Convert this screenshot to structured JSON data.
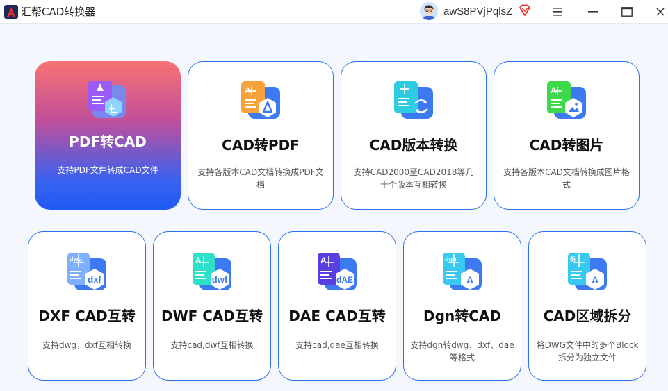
{
  "app": {
    "title": "汇帮CAD转换器",
    "username": "awS8PVjPqlsZ"
  },
  "icons": {
    "logo": "app-logo-icon",
    "avatar": "user-avatar",
    "vip": "vip-diamond-icon",
    "menu": "hamburger-menu-icon",
    "minimize": "minimize-icon",
    "maximize": "maximize-icon",
    "close": "close-icon"
  },
  "colors": {
    "accent": "#2a6ff0",
    "active_gradient_top": "#f87272",
    "active_gradient_bottom": "#1e5af2",
    "background": "#f4f7fd"
  },
  "cards": [
    {
      "title": "PDF转CAD",
      "desc": "支持PDF文件转成CAD文件",
      "active": true,
      "icon": "pdf-to-cad-icon"
    },
    {
      "title": "CAD转PDF",
      "desc": "支持各版本CAD文档转换成PDF文档",
      "active": false,
      "icon": "cad-to-pdf-icon"
    },
    {
      "title": "CAD版本转换",
      "desc": "支持CAD2000至CAD2018等几十个版本互相转换",
      "active": false,
      "icon": "cad-version-convert-icon"
    },
    {
      "title": "CAD转图片",
      "desc": "支持各版本CAD文档转换成图片格式",
      "active": false,
      "icon": "cad-to-image-icon"
    },
    {
      "title": "DXF CAD互转",
      "desc": "支持dwg，dxf互相转换",
      "active": false,
      "icon": "dxf-convert-icon",
      "badge": "dxf",
      "tag": "dwg"
    },
    {
      "title": "DWF CAD互转",
      "desc": "支持cad,dwf互相转换",
      "active": false,
      "icon": "dwf-convert-icon",
      "badge": "dwf",
      "tag": "A"
    },
    {
      "title": "DAE CAD互转",
      "desc": "支持cad,dae互相转换",
      "active": false,
      "icon": "dae-convert-icon",
      "badge": "dAE",
      "tag": "A"
    },
    {
      "title": "Dgn转CAD",
      "desc": "支持dgn转dwg、dxf、dae等格式",
      "active": false,
      "icon": "dgn-to-cad-icon",
      "badge": "A",
      "tag": "dgn"
    },
    {
      "title": "CAD区域拆分",
      "desc": "将DWG文件中的多个Block拆分为独立文件",
      "active": false,
      "icon": "cad-region-split-icon",
      "badge": "A",
      "tag": "拆"
    }
  ]
}
